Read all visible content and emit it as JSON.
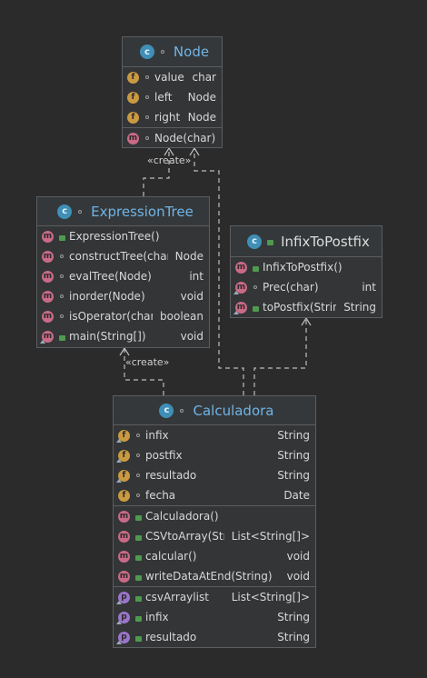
{
  "diagram": {
    "labels": {
      "create_top": "«create»",
      "create_bottom": "«create»"
    },
    "badges": {
      "field": "f",
      "method": "m",
      "property": "p",
      "class": "c"
    },
    "node": {
      "name": "Node",
      "fields": [
        {
          "name": "value",
          "type": "char"
        },
        {
          "name": "left",
          "type": "Node"
        },
        {
          "name": "right",
          "type": "Node"
        }
      ],
      "methods": [
        {
          "name": "Node(char)",
          "type": ""
        }
      ]
    },
    "expression_tree": {
      "name": "ExpressionTree",
      "methods": [
        {
          "name": "ExpressionTree()",
          "type": ""
        },
        {
          "name": "constructTree(char[])",
          "type": "Node"
        },
        {
          "name": "evalTree(Node)",
          "type": "int"
        },
        {
          "name": "inorder(Node)",
          "type": "void"
        },
        {
          "name": "isOperator(char)",
          "type": "boolean"
        },
        {
          "name": "main(String[])",
          "type": "void"
        }
      ]
    },
    "infix_to_postfix": {
      "name": "InfixToPostfix",
      "methods": [
        {
          "name": "InfixToPostfix()",
          "type": ""
        },
        {
          "name": "Prec(char)",
          "type": "int"
        },
        {
          "name": "toPostfix(String)",
          "type": "String"
        }
      ]
    },
    "calculadora": {
      "name": "Calculadora",
      "fields": [
        {
          "name": "infix",
          "type": "String"
        },
        {
          "name": "postfix",
          "type": "String"
        },
        {
          "name": "resultado",
          "type": "String"
        },
        {
          "name": "fecha",
          "type": "Date"
        }
      ],
      "methods": [
        {
          "name": "Calculadora()",
          "type": ""
        },
        {
          "name": "CSVtoArray(String)",
          "type": "List<String[]>"
        },
        {
          "name": "calcular()",
          "type": "void"
        },
        {
          "name": "writeDataAtEnd(String)",
          "type": "void"
        }
      ],
      "properties": [
        {
          "name": "csvArraylist",
          "type": "List<String[]>"
        },
        {
          "name": "infix",
          "type": "String"
        },
        {
          "name": "resultado",
          "type": "String"
        }
      ]
    }
  }
}
